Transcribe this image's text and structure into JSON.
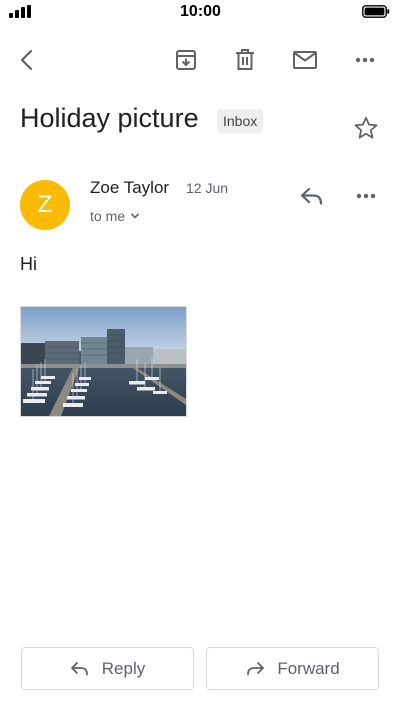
{
  "status_bar": {
    "time": "10:00"
  },
  "toolbar": {
    "icons": [
      "back-icon",
      "archive-icon",
      "delete-icon",
      "mail-icon",
      "more-icon"
    ]
  },
  "email": {
    "subject": "Holiday picture",
    "label": "Inbox",
    "sender": {
      "initial": "Z",
      "name": "Zoe Taylor",
      "avatar_color": "#f9bc03"
    },
    "date": "12 Jun",
    "recipients": "to me",
    "body": "Hi"
  },
  "actions": {
    "reply_label": "Reply",
    "forward_label": "Forward"
  },
  "colors": {
    "text_primary": "#202124",
    "text_secondary": "#5f6368",
    "border": "#dadce0",
    "label_bg": "#eeeeee"
  }
}
